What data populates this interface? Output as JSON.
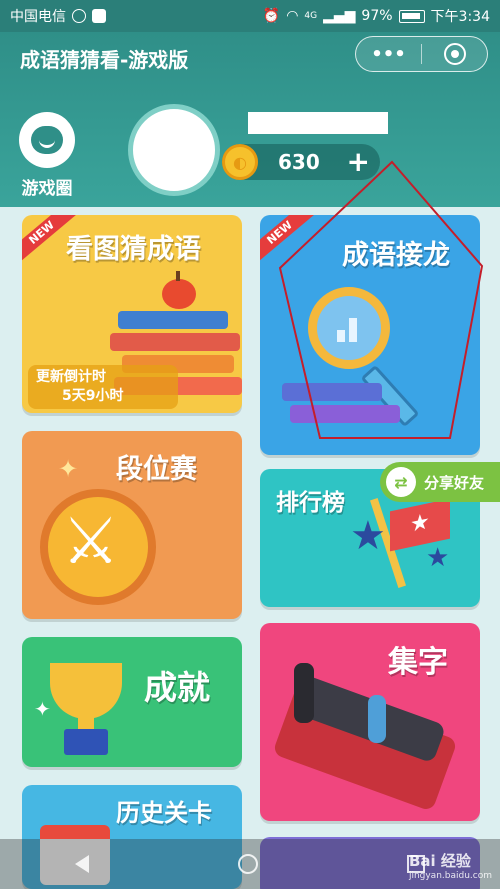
{
  "status_bar": {
    "carrier": "中国电信",
    "signal": "4G",
    "battery": "97%",
    "time": "下午3:34"
  },
  "header": {
    "title": "成语猜猜看-游戏版",
    "capsule_more": "•••",
    "game_circle_label": "游戏圈",
    "coins": "630",
    "coin_add": "+"
  },
  "cards": {
    "kantu": {
      "title": "看图猜成语",
      "badge": "NEW",
      "countdown_label": "更新倒计时",
      "countdown_value": "5天9小时"
    },
    "jielong": {
      "title": "成语接龙",
      "badge": "NEW"
    },
    "duanwei": {
      "title": "段位赛"
    },
    "paihang": {
      "title": "排行榜"
    },
    "chengjiu": {
      "title": "成就"
    },
    "jizi": {
      "title": "集字"
    },
    "lishi": {
      "title": "历史关卡"
    }
  },
  "share": {
    "label": "分享好友"
  },
  "watermark": {
    "brand": "Bai 经验",
    "url": "jingyan.baidu.com"
  },
  "colors": {
    "header_bg": "#2f8f88",
    "annotation": "#c41e2a"
  }
}
